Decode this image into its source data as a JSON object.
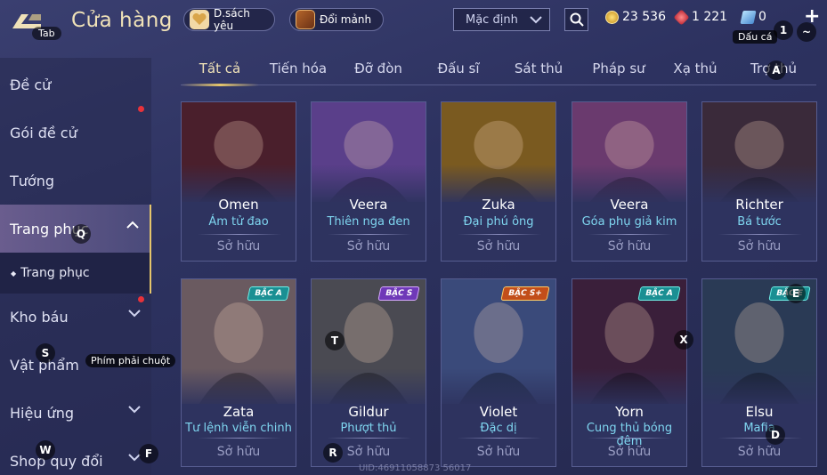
{
  "header": {
    "title": "Cửa hàng",
    "back_key": "Tab",
    "wishlist_label": "D.sách yêu",
    "shard_label": "Đổi mảnh",
    "sort_value": "Mặc định"
  },
  "currency": {
    "gold": "23 536",
    "gems": "1 221",
    "vouchers": "0",
    "voucher_tooltip": "Dấu cá",
    "key_1": "1",
    "key_tilde": "~"
  },
  "sidebar": {
    "items": [
      {
        "label": "Đề cử"
      },
      {
        "label": "Gói đề cử"
      },
      {
        "label": "Tướng"
      },
      {
        "label": "Trang phục"
      },
      {
        "label": "Kho báu"
      },
      {
        "label": "Vật phẩm"
      },
      {
        "label": "Hiệu ứng"
      },
      {
        "label": "Shop quy đổi"
      }
    ],
    "subitem": "Trang phục"
  },
  "tabs": [
    "Tất cả",
    "Tiến hóa",
    "Đỡ đòn",
    "Đấu sĩ",
    "Sát thủ",
    "Pháp sư",
    "Xạ thủ",
    "Trợ thủ"
  ],
  "cards": [
    {
      "hero": "Omen",
      "skin": "Ám tử đao",
      "status": "Sở hữu",
      "color": "#4a1f2c"
    },
    {
      "hero": "Veera",
      "skin": "Thiên nga đen",
      "status": "Sở hữu",
      "color": "#5a3f8a"
    },
    {
      "hero": "Zuka",
      "skin": "Đại phú ông",
      "status": "Sở hữu",
      "color": "#7a5a20"
    },
    {
      "hero": "Veera",
      "skin": "Góa phụ giả kim",
      "status": "Sở hữu",
      "color": "#6a3a6e"
    },
    {
      "hero": "Richter",
      "skin": "Bá tước",
      "status": "Sở hữu",
      "color": "#3a2a3a"
    },
    {
      "hero": "Zata",
      "skin": "Tư lệnh viễn chinh",
      "status": "Sở hữu",
      "badge": "BẬC A",
      "badge_class": "a",
      "color": "#6a5a60"
    },
    {
      "hero": "Gildur",
      "skin": "Phượt thủ",
      "status": "Sở hữu",
      "badge": "BẬC S",
      "badge_class": "s",
      "color": "#4a4a52"
    },
    {
      "hero": "Violet",
      "skin": "Đặc dị",
      "status": "Sở hữu",
      "badge": "BẬC S+",
      "badge_class": "sp",
      "color": "#3a4a7a"
    },
    {
      "hero": "Yorn",
      "skin": "Cung thủ bóng đêm",
      "status": "Sở hữu",
      "badge": "BẬC A",
      "badge_class": "a",
      "color": "#3a1f3a"
    },
    {
      "hero": "Elsu",
      "skin": "Mafia",
      "status": "Sở hữu",
      "badge": "BẬC E",
      "badge_class": "a",
      "color": "#2a3a55"
    }
  ],
  "hotkeys": {
    "q": "Q",
    "a": "A",
    "s": "S",
    "t": "T",
    "x": "X",
    "e": "E",
    "w": "W",
    "f": "F",
    "r": "R",
    "d": "D"
  },
  "tooltip_rmb": "Phím phải chuột",
  "uid": "UID:46911058873 56017",
  "colors": {
    "accent": "#e5c56b",
    "skin_text": "#7fd6f0",
    "alert": "#e8323a"
  }
}
